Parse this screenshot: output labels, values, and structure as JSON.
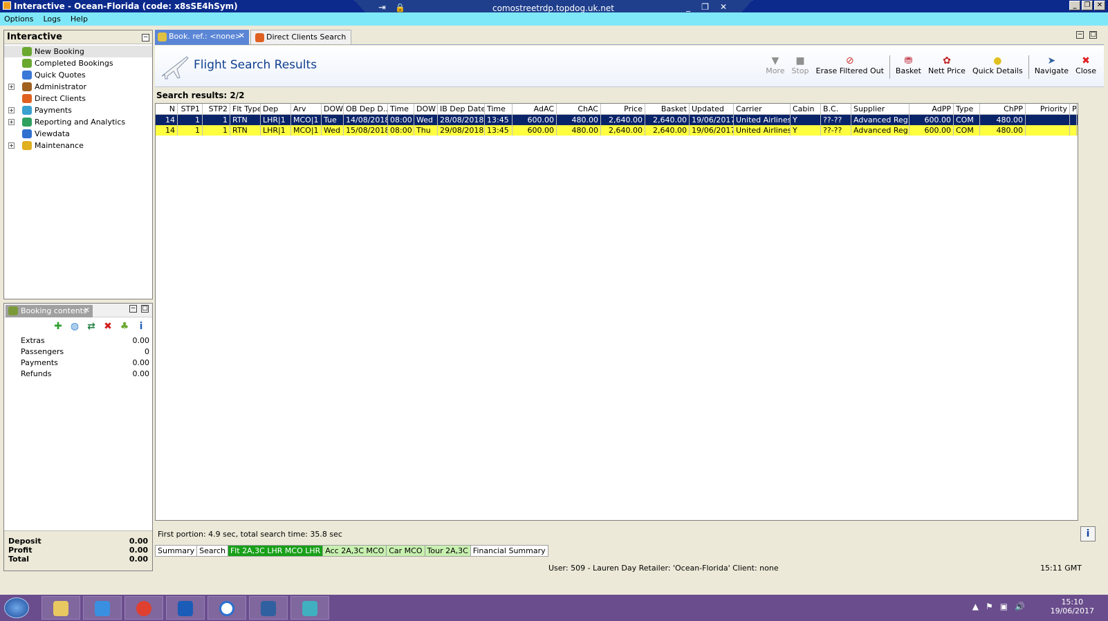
{
  "window": {
    "title": "Interactive - Ocean-Florida (code: x8sSE4hSym)"
  },
  "rdp": {
    "host": "comostreetrdp.topdog.uk.net"
  },
  "menu": [
    "Options",
    "Logs",
    "Help"
  ],
  "nav": {
    "title": "Interactive",
    "items": [
      {
        "label": "New Booking",
        "expand": "",
        "icon": "palm-tree-icon",
        "color": "#6aa830"
      },
      {
        "label": "Completed Bookings",
        "expand": "",
        "icon": "palm-tree-icon",
        "color": "#6aa830"
      },
      {
        "label": "Quick Quotes",
        "expand": "",
        "icon": "clock-icon",
        "color": "#3a78d8"
      },
      {
        "label": "Administrator",
        "expand": "+",
        "icon": "admin-user-icon",
        "color": "#a06020"
      },
      {
        "label": "Direct Clients",
        "expand": "",
        "icon": "direct-clients-icon",
        "color": "#e06020"
      },
      {
        "label": "Payments",
        "expand": "+",
        "icon": "payments-icon",
        "color": "#3aa0d0"
      },
      {
        "label": "Reporting and Analytics",
        "expand": "+",
        "icon": "report-icon",
        "color": "#30a060"
      },
      {
        "label": "Viewdata",
        "expand": "",
        "icon": "globe-icon",
        "color": "#3070d0"
      },
      {
        "label": "Maintenance",
        "expand": "+",
        "icon": "tools-icon",
        "color": "#e0b020"
      }
    ]
  },
  "booking": {
    "title": "Booking contents",
    "rows": [
      {
        "label": "Extras",
        "value": "0.00"
      },
      {
        "label": "Passengers",
        "value": "0"
      },
      {
        "label": "Payments",
        "value": "0.00"
      },
      {
        "label": "Refunds",
        "value": "0.00"
      }
    ],
    "deposit_label": "Deposit",
    "deposit": "0.00",
    "profit_label": "Profit",
    "profit": "0.00",
    "total_label": "Total",
    "total": "0.00"
  },
  "tabs": {
    "tab1": "Book. ref.: <none>",
    "tab2": "Direct Clients Search"
  },
  "header": {
    "title": "Flight Search Results"
  },
  "toolbar": {
    "more": "More",
    "stop": "Stop",
    "erase": "Erase Filtered Out",
    "basket": "Basket",
    "nett": "Nett Price",
    "details": "Quick Details",
    "navigate": "Navigate",
    "close": "Close"
  },
  "search_results": "Search results: 2/2",
  "grid": {
    "columns": [
      "N",
      "STP1",
      "STP2",
      "Flt Type",
      "Dep",
      "Arv",
      "DOW",
      "OB Dep D...",
      "Time",
      "DOW",
      "IB Dep Date",
      "Time",
      "AdAC",
      "ChAC",
      "Price",
      "Basket",
      "Updated",
      "Carrier",
      "Cabin",
      "B.C.",
      "Supplier",
      "AdPP",
      "Type",
      "ChPP",
      "Priority",
      "Pr"
    ],
    "rows": [
      [
        "14",
        "1",
        "1",
        "RTN",
        "LHR|1",
        "MCO|1",
        "Tue",
        "14/08/2018",
        "08:00",
        "Wed",
        "28/08/2018",
        "13:45",
        "600.00",
        "480.00",
        "2,640.00",
        "2,640.00",
        "19/06/2017",
        "United Airlines",
        "Y",
        "??-??",
        "Advanced Reg",
        "600.00",
        "COM",
        "480.00",
        "",
        ""
      ],
      [
        "14",
        "1",
        "1",
        "RTN",
        "LHR|1",
        "MCO|1",
        "Wed",
        "15/08/2018",
        "08:00",
        "Thu",
        "29/08/2018",
        "13:45",
        "600.00",
        "480.00",
        "2,640.00",
        "2,640.00",
        "19/06/2017",
        "United Airlines",
        "Y",
        "??-??",
        "Advanced Reg",
        "600.00",
        "COM",
        "480.00",
        "",
        ""
      ]
    ]
  },
  "status": "First portion: 4.9 sec, total search time: 35.8 sec",
  "bottom_tabs": [
    "Summary",
    "Search",
    "Flt 2A,3C LHR MCO LHR",
    "Acc 2A,3C MCO",
    "Car MCO",
    "Tour 2A,3C",
    "Financial Summary"
  ],
  "app_status": {
    "user": "User: 509 - Lauren Day     Retailer: 'Ocean-Florida'     Client: none",
    "time": "15:11 GMT"
  },
  "taskbar": {
    "clock": "15:10",
    "date": "19/06/2017"
  }
}
